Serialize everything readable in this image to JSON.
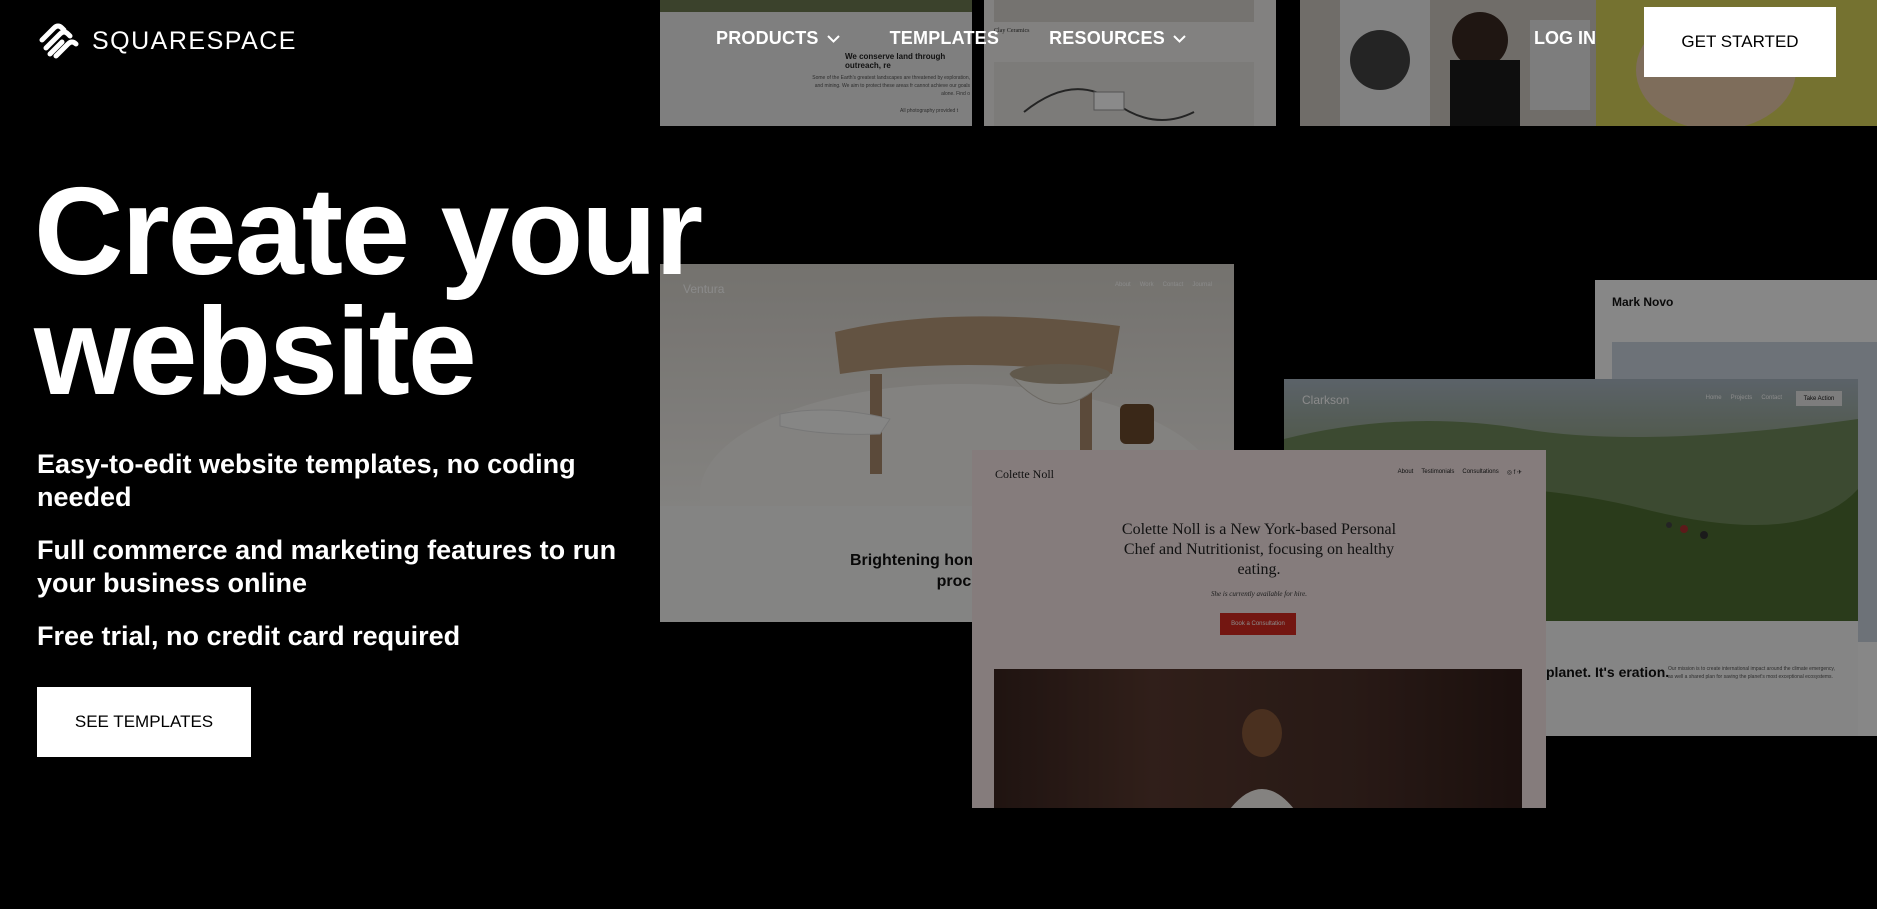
{
  "header": {
    "brand": "SQUARESPACE",
    "nav": [
      {
        "label": "PRODUCTS",
        "has_dropdown": true
      },
      {
        "label": "TEMPLATES",
        "has_dropdown": false
      },
      {
        "label": "RESOURCES",
        "has_dropdown": true
      }
    ],
    "login_label": "LOG IN",
    "cta_label": "GET STARTED"
  },
  "hero": {
    "title_line1": "Create your",
    "title_line2": "website",
    "bullets": [
      "Easy-to-edit website templates, no coding needed",
      "Full commerce and marketing features to run your business online",
      "Free trial, no credit card required"
    ],
    "cta_label": "SEE TEMPLATES"
  },
  "previews": {
    "top_left_text": "We conserve land through outreach, re",
    "top_left_body": "Some of the Earth's greatest landscapes are threatened by exploration, and mining. We aim to protect these areas fr cannot achieve our goals alone. Find o",
    "top_left_credit": "All photography provided t",
    "top_middle_caption": "Clay Ceramics",
    "ventura": {
      "title": "Ventura",
      "caption": "Brightening homes durable proc"
    },
    "mark_novo": {
      "name": "Mark Novo"
    },
    "clarkson": {
      "title": "Clarkson",
      "button": "Take Action",
      "text": "planet. It's eration."
    },
    "colette": {
      "name": "Colette Noll",
      "links": [
        "About",
        "Testimonials",
        "Consultations"
      ],
      "headline": "Colette Noll is a New York-based Personal Chef and Nutritionist, focusing on healthy eating.",
      "subline": "She is currently available for hire.",
      "button": "Book a Consultation"
    }
  },
  "colors": {
    "background": "#000000",
    "text": "#ffffff",
    "button_bg": "#ffffff",
    "button_text": "#000000",
    "colette_accent": "#d42a20"
  }
}
